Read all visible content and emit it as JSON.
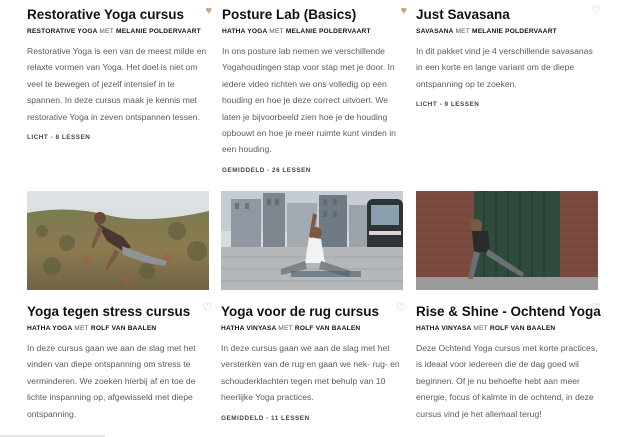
{
  "courses": [
    {
      "title": "Restorative Yoga cursus",
      "category": "RESTORATIVE YOGA",
      "met": "MET",
      "teacher": "MELANIE POLDERVAART",
      "description": "Restorative Yoga is een van de meest milde en relaxte vormen van Yoga. Het doel is niet om veel te bewegen of jezelf intensief in te spannen. In deze cursus maak je kennis met restorative Yoga in zeven ontspannen lessen.",
      "level": "LICHT - 8 LESSEN",
      "heart_icon": "heart-filled-icon"
    },
    {
      "title": "Posture Lab (Basics)",
      "category": "HATHA YOGA",
      "met": "MET",
      "teacher": "MELANIE POLDERVAART",
      "description": "In ons posture lab nemen we verschillende Yogahoudingen stap voor stap met je door. In iedere video richten we ons volledig op een houding en hoe je deze correct uitvoert. We laten je bijvoorbeeld zien hoe je de houding opbouwt en hoe je meer ruimte kunt vinden in een houding.",
      "level": "GEMIDDELD - 26 LESSEN",
      "heart_icon": "heart-filled-icon"
    },
    {
      "title": "Just Savasana",
      "category": "SAVASANA",
      "met": "MET",
      "teacher": "MELANIE POLDERVAART",
      "description": "In dit pakket vind je 4 verschillende savasanas in een korte en lange variant om de diepe ontspanning op te zoeken.",
      "level": "LICHT - 9 LESSEN",
      "heart_icon": "heart-outline-icon"
    },
    {
      "title": "Yoga tegen stress cursus",
      "category": "HATHA YOGA",
      "met": "MET",
      "teacher": "ROLF VAN BAALEN",
      "description": "In deze cursus gaan we aan de slag met het vinden van diepe ontspanning om stress te verminderen. We zoeken hierbij af en toe de lichte inspanning op, afgewisseld met diepe ontspanning.",
      "level": "",
      "heart_icon": "heart-outline-icon"
    },
    {
      "title": "Yoga voor de rug cursus",
      "category": "HATHA VINYASA",
      "met": "MET",
      "teacher": "ROLF VAN BAALEN",
      "description": "In deze cursus gaan we aan de slag met het versterken van de rug en gaan we nek- rug- en schouderklachten tegen met behulp van 10 heerlijke Yoga practices.",
      "level": "GEMIDDELD - 11 LESSEN",
      "heart_icon": "heart-outline-icon"
    },
    {
      "title": "Rise & Shine - Ochtend Yoga",
      "category": "HATHA VINYASA",
      "met": "MET",
      "teacher": "ROLF VAN BAALEN",
      "description": "Deze Ochtend Yoga cursus met korte practices, is ideaal voor iedereen die de dag goed wil beginnen. Of je nu behoefte hebt aan meer energie, focus of kalmte in de ochtend, in deze cursus vind je het allemaal terug!",
      "level": "",
      "heart_icon": "heart-outline-icon"
    }
  ],
  "photos": [
    {
      "subject": "man-stretching-in-field-photo"
    },
    {
      "subject": "man-stretching-on-street-photo"
    },
    {
      "subject": "man-standing-balance-pose-photo"
    }
  ]
}
